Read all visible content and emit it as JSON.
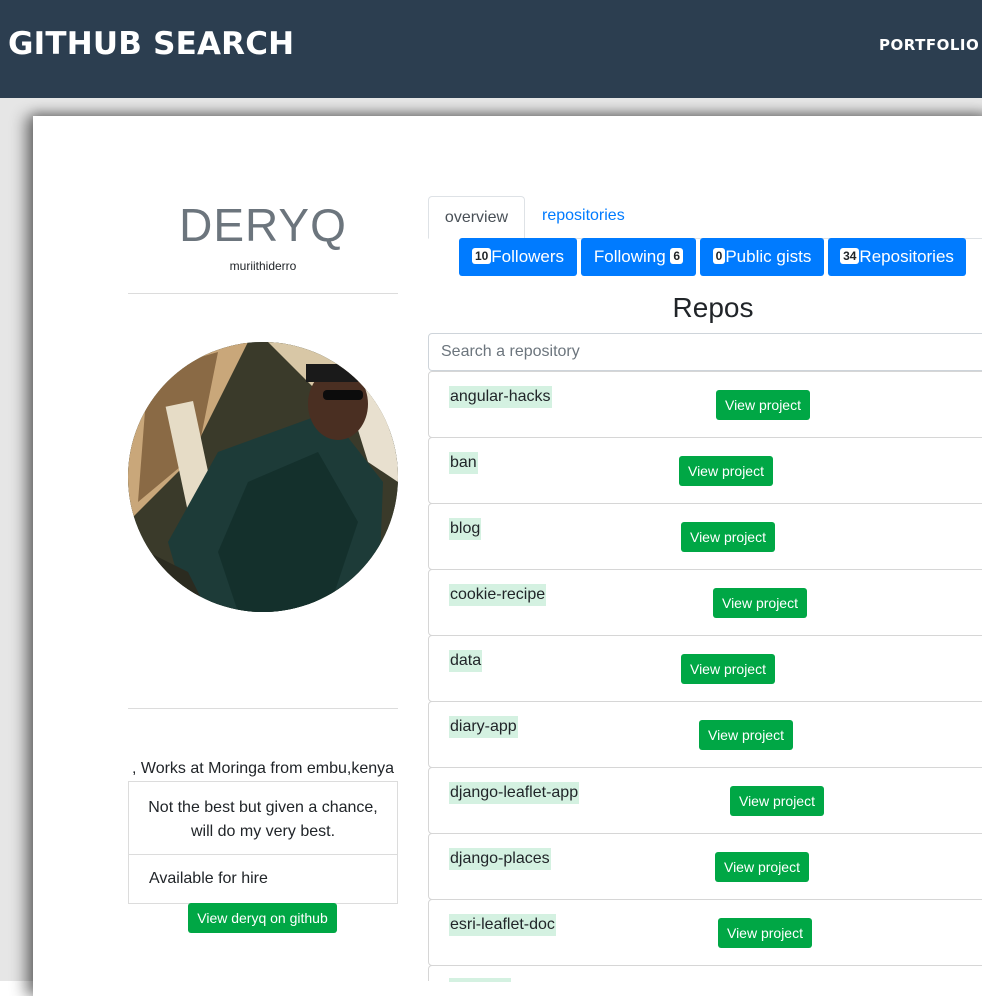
{
  "navbar": {
    "brand": "GITHUB SEARCH",
    "link": "PORTFOLIO"
  },
  "profile": {
    "name": "DERYQ",
    "login": "muriithiderro",
    "works": ", Works at Moringa from embu,kenya",
    "bio": "Not the best but given a chance, will do my very best.",
    "hire": "Available for hire",
    "github_button": "View deryq on github"
  },
  "tabs": {
    "overview": "overview",
    "repositories": "repositories"
  },
  "stats": [
    {
      "count": "10",
      "label": "Followers",
      "badge_first": true
    },
    {
      "count": "6",
      "label": "Following",
      "badge_first": false
    },
    {
      "count": "0",
      "label": "Public gists",
      "badge_first": true
    },
    {
      "count": "34",
      "label": "Repositories",
      "badge_first": true
    }
  ],
  "repos_title": "Repos",
  "search": {
    "placeholder": "Search a repository"
  },
  "view_project_label": "View project",
  "repos": [
    "angular-hacks",
    "ban",
    "blog",
    "cookie-recipe",
    "data",
    "diary-app",
    "django-leaflet-app",
    "django-places",
    "esri-leaflet-doc"
  ],
  "colors": {
    "navbar": "#2c3e50",
    "primary": "#007bff",
    "success": "#00a745",
    "highlight": "#d4f1e1"
  }
}
